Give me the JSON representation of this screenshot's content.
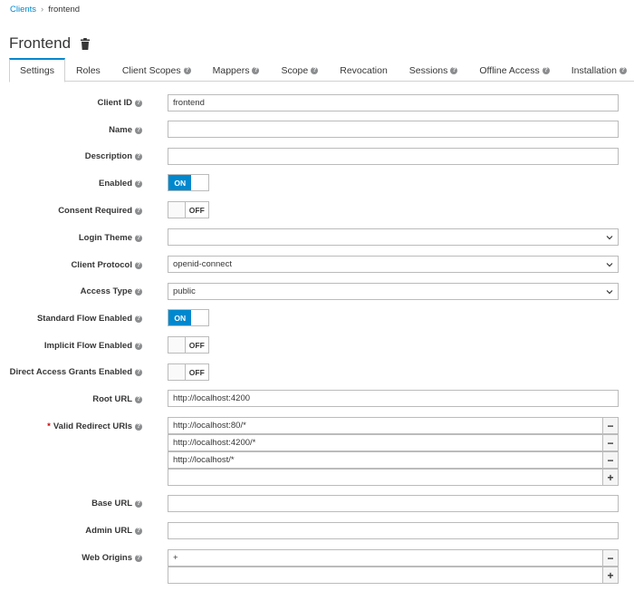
{
  "breadcrumb": {
    "root": "Clients",
    "separator": "›",
    "current": "frontend"
  },
  "page": {
    "title": "Frontend",
    "icon": "trash-icon"
  },
  "tabs": [
    {
      "label": "Settings",
      "help": false
    },
    {
      "label": "Roles",
      "help": false
    },
    {
      "label": "Client Scopes",
      "help": true
    },
    {
      "label": "Mappers",
      "help": true
    },
    {
      "label": "Scope",
      "help": true
    },
    {
      "label": "Revocation",
      "help": false
    },
    {
      "label": "Sessions",
      "help": true
    },
    {
      "label": "Offline Access",
      "help": true
    },
    {
      "label": "Installation",
      "help": true
    }
  ],
  "help_glyph": "?",
  "form": {
    "client_id": {
      "label": "Client ID",
      "value": "frontend"
    },
    "name": {
      "label": "Name",
      "value": ""
    },
    "description": {
      "label": "Description",
      "value": ""
    },
    "enabled": {
      "label": "Enabled",
      "state": "ON"
    },
    "consent_required": {
      "label": "Consent Required",
      "state": "OFF"
    },
    "login_theme": {
      "label": "Login Theme",
      "value": ""
    },
    "client_protocol": {
      "label": "Client Protocol",
      "value": "openid-connect"
    },
    "access_type": {
      "label": "Access Type",
      "value": "public"
    },
    "standard_flow": {
      "label": "Standard Flow Enabled",
      "state": "ON"
    },
    "implicit_flow": {
      "label": "Implicit Flow Enabled",
      "state": "OFF"
    },
    "direct_access": {
      "label": "Direct Access Grants Enabled",
      "state": "OFF"
    },
    "root_url": {
      "label": "Root URL",
      "value": "http://localhost:4200"
    },
    "redirect_uris": {
      "required_mark": "*",
      "label": "Valid Redirect URIs",
      "values": [
        "http://localhost:80/*",
        "http://localhost:4200/*",
        "http://localhost/*"
      ]
    },
    "base_url": {
      "label": "Base URL",
      "value": ""
    },
    "admin_url": {
      "label": "Admin URL",
      "value": ""
    },
    "web_origins": {
      "label": "Web Origins",
      "values": [
        "+"
      ]
    }
  },
  "buttons": {
    "remove": "−",
    "add": "+"
  },
  "colors": {
    "accent": "#0088ce",
    "required": "#cc0000"
  }
}
